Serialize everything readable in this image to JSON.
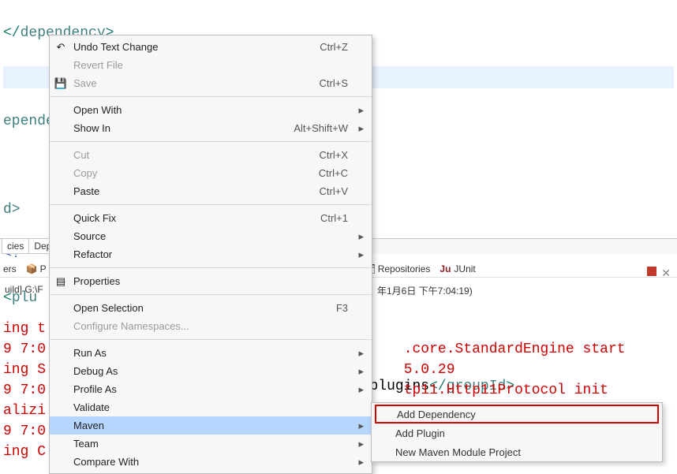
{
  "code": {
    "line1_open": "</",
    "line1_tag": "dependency",
    "line1_close": ">",
    "line3": "ependency",
    "line5": "d>",
    "line6": "<!--",
    "line7_open": "<",
    "line7_tag": "plu",
    "line9_pre": ".plugins",
    "line9_close_open": "</",
    "line9_close_tag": "groupId",
    "line9_close_end": ">"
  },
  "ctx": {
    "undo": "Undo Text Change",
    "undo_k": "Ctrl+Z",
    "revert": "Revert File",
    "save": "Save",
    "save_k": "Ctrl+S",
    "openwith": "Open With",
    "showin": "Show In",
    "showin_k": "Alt+Shift+W",
    "cut": "Cut",
    "cut_k": "Ctrl+X",
    "copy": "Copy",
    "copy_k": "Ctrl+C",
    "paste": "Paste",
    "paste_k": "Ctrl+V",
    "quickfix": "Quick Fix",
    "quickfix_k": "Ctrl+1",
    "source": "Source",
    "refactor": "Refactor",
    "properties": "Properties",
    "opensel": "Open Selection",
    "opensel_k": "F3",
    "confns": "Configure Namespaces...",
    "runas": "Run As",
    "debugas": "Debug As",
    "profileas": "Profile As",
    "validate": "Validate",
    "maven": "Maven",
    "team": "Team",
    "compare": "Compare With"
  },
  "submenu": {
    "adddep": "Add Dependency",
    "addplugin": "Add Plugin",
    "newmod": "New Maven Module Project"
  },
  "tabs": {
    "t1": "cies",
    "t2": "Dep"
  },
  "views": {
    "v1": "ers",
    "v2": "P",
    "v3": "Repositories",
    "v4": "JUnit",
    "v4pre": "Ju"
  },
  "console_head": {
    "left": "uild] G:\\F",
    "right": "年1月6日 下午7:04:19)"
  },
  "console": {
    "l1a": "ing t",
    "l2a": "9 7:0",
    "l2b": ".core.StandardEngine start",
    "l3a": "ing S",
    "l3b": "5.0.29",
    "l4a": "9 7:0",
    "l4b": "tp11.Http11Protocol init",
    "l5a": "alizi",
    "l6a": "9 7:0",
    "l7a": "ing C"
  }
}
